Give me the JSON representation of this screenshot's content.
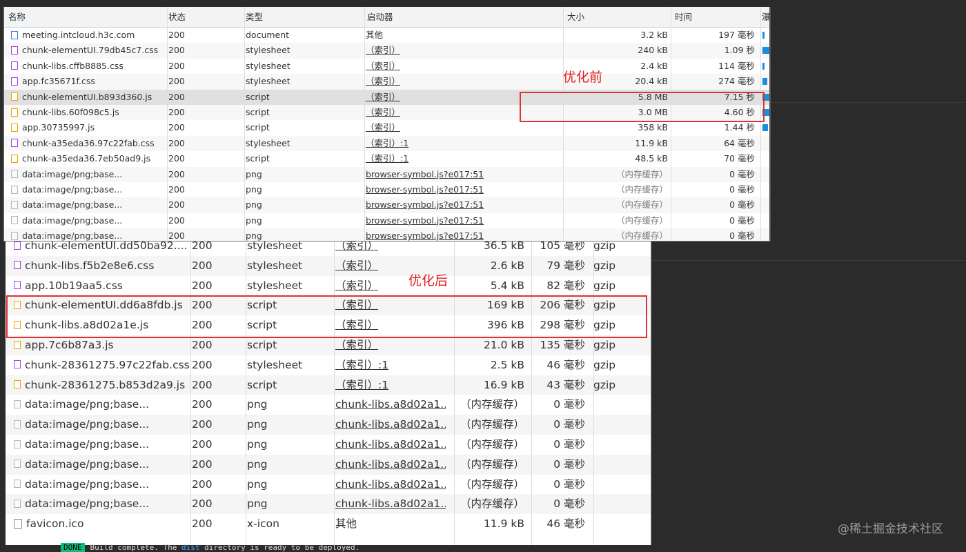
{
  "annotations": {
    "before": "优化前",
    "after": "优化后"
  },
  "before_panel": {
    "headers": {
      "name": "名称",
      "status": "状态",
      "type": "类型",
      "initiator": "启动器",
      "size": "大小",
      "time": "时间",
      "waterfall": "瀑布"
    },
    "rows": [
      {
        "name": "meeting.intcloud.h3c.com",
        "icon": "doc",
        "status": "200",
        "type": "document",
        "initiator": "其他",
        "size": "3.2 kB",
        "time": "197 毫秒"
      },
      {
        "name": "chunk-elementUI.79db45c7.css",
        "icon": "css",
        "status": "200",
        "type": "stylesheet",
        "initiator": "（索引）",
        "size": "240 kB",
        "time": "1.09 秒"
      },
      {
        "name": "chunk-libs.cffb8885.css",
        "icon": "css",
        "status": "200",
        "type": "stylesheet",
        "initiator": "（索引）",
        "size": "2.4 kB",
        "time": "114 毫秒"
      },
      {
        "name": "app.fc35671f.css",
        "icon": "css",
        "status": "200",
        "type": "stylesheet",
        "initiator": "（索引）",
        "size": "20.4 kB",
        "time": "274 毫秒"
      },
      {
        "name": "chunk-elementUI.b893d360.js",
        "icon": "js",
        "status": "200",
        "type": "script",
        "initiator": "（索引）",
        "size": "5.8 MB",
        "time": "7.15 秒"
      },
      {
        "name": "chunk-libs.60f098c5.js",
        "icon": "js",
        "status": "200",
        "type": "script",
        "initiator": "（索引）",
        "size": "3.0 MB",
        "time": "4.60 秒"
      },
      {
        "name": "app.30735997.js",
        "icon": "js",
        "status": "200",
        "type": "script",
        "initiator": "（索引）",
        "size": "358 kB",
        "time": "1.44 秒"
      },
      {
        "name": "chunk-a35eda36.97c22fab.css",
        "icon": "css",
        "status": "200",
        "type": "stylesheet",
        "initiator": "（索引）:1",
        "size": "11.9 kB",
        "time": "64 毫秒"
      },
      {
        "name": "chunk-a35eda36.7eb50ad9.js",
        "icon": "js",
        "status": "200",
        "type": "script",
        "initiator": "（索引）:1",
        "size": "48.5 kB",
        "time": "70 毫秒"
      },
      {
        "name": "data:image/png;base...",
        "icon": "png",
        "status": "200",
        "type": "png",
        "initiator": "browser-symbol.js?e017:51",
        "size": "（内存缓存）",
        "time": "0 毫秒"
      },
      {
        "name": "data:image/png;base...",
        "icon": "png",
        "status": "200",
        "type": "png",
        "initiator": "browser-symbol.js?e017:51",
        "size": "（内存缓存）",
        "time": "0 毫秒"
      },
      {
        "name": "data:image/png;base...",
        "icon": "png",
        "status": "200",
        "type": "png",
        "initiator": "browser-symbol.js?e017:51",
        "size": "（内存缓存）",
        "time": "0 毫秒"
      },
      {
        "name": "data:image/png;base...",
        "icon": "png",
        "status": "200",
        "type": "png",
        "initiator": "browser-symbol.js?e017:51",
        "size": "（内存缓存）",
        "time": "0 毫秒"
      },
      {
        "name": "data:image/png;base...",
        "icon": "png",
        "status": "200",
        "type": "png",
        "initiator": "browser-symbol.js?e017:51",
        "size": "（内存缓存）",
        "time": "0 毫秒"
      }
    ]
  },
  "after_panel": {
    "rows": [
      {
        "name": "chunk-elementUI.dd50ba92....",
        "icon": "css",
        "status": "200",
        "type": "stylesheet",
        "initiator": "（索引）",
        "size": "36.5 kB",
        "time": "105 毫秒",
        "protocol": "gzip"
      },
      {
        "name": "chunk-libs.f5b2e8e6.css",
        "icon": "css",
        "status": "200",
        "type": "stylesheet",
        "initiator": "（索引）",
        "size": "2.6 kB",
        "time": "79 毫秒",
        "protocol": "gzip"
      },
      {
        "name": "app.10b19aa5.css",
        "icon": "css",
        "status": "200",
        "type": "stylesheet",
        "initiator": "（索引）",
        "size": "5.4 kB",
        "time": "82 毫秒",
        "protocol": "gzip"
      },
      {
        "name": "chunk-elementUI.dd6a8fdb.js",
        "icon": "js",
        "status": "200",
        "type": "script",
        "initiator": "（索引）",
        "size": "169 kB",
        "time": "206 毫秒",
        "protocol": "gzip"
      },
      {
        "name": "chunk-libs.a8d02a1e.js",
        "icon": "js",
        "status": "200",
        "type": "script",
        "initiator": "（索引）",
        "size": "396 kB",
        "time": "298 毫秒",
        "protocol": "gzip"
      },
      {
        "name": "app.7c6b87a3.js",
        "icon": "js",
        "status": "200",
        "type": "script",
        "initiator": "（索引）",
        "size": "21.0 kB",
        "time": "135 毫秒",
        "protocol": "gzip"
      },
      {
        "name": "chunk-28361275.97c22fab.css",
        "icon": "css",
        "status": "200",
        "type": "stylesheet",
        "initiator": "（索引）:1",
        "size": "2.5 kB",
        "time": "46 毫秒",
        "protocol": "gzip"
      },
      {
        "name": "chunk-28361275.b853d2a9.js",
        "icon": "js",
        "status": "200",
        "type": "script",
        "initiator": "（索引）:1",
        "size": "16.9 kB",
        "time": "43 毫秒",
        "protocol": "gzip"
      },
      {
        "name": "data:image/png;base...",
        "icon": "png",
        "status": "200",
        "type": "png",
        "initiator": "chunk-libs.a8d02a1...",
        "size": "（内存缓存）",
        "time": "0 毫秒",
        "protocol": ""
      },
      {
        "name": "data:image/png;base...",
        "icon": "png",
        "status": "200",
        "type": "png",
        "initiator": "chunk-libs.a8d02a1...",
        "size": "（内存缓存）",
        "time": "0 毫秒",
        "protocol": ""
      },
      {
        "name": "data:image/png;base...",
        "icon": "png",
        "status": "200",
        "type": "png",
        "initiator": "chunk-libs.a8d02a1...",
        "size": "（内存缓存）",
        "time": "0 毫秒",
        "protocol": ""
      },
      {
        "name": "data:image/png;base...",
        "icon": "png",
        "status": "200",
        "type": "png",
        "initiator": "chunk-libs.a8d02a1...",
        "size": "（内存缓存）",
        "time": "0 毫秒",
        "protocol": ""
      },
      {
        "name": "data:image/png;base...",
        "icon": "png",
        "status": "200",
        "type": "png",
        "initiator": "chunk-libs.a8d02a1...",
        "size": "（内存缓存）",
        "time": "0 毫秒",
        "protocol": ""
      },
      {
        "name": "data:image/png;base...",
        "icon": "png",
        "status": "200",
        "type": "png",
        "initiator": "chunk-libs.a8d02a1...",
        "size": "（内存缓存）",
        "time": "0 毫秒",
        "protocol": ""
      },
      {
        "name": "favicon.ico",
        "icon": "ico",
        "status": "200",
        "type": "x-icon",
        "initiator": "其他",
        "size": "11.9 kB",
        "time": "46 毫秒",
        "protocol": ""
      }
    ]
  },
  "terminal": {
    "badge": "DONE",
    "text_before": "Build complete. The",
    "highlight": "dist",
    "text_after": "directory is ready to be deployed."
  },
  "watermark": "@稀土掘金技术社区",
  "colors": {
    "highlight_box": "#e03030",
    "annotation": "#e41d1d",
    "waterfall": "#1a8fdc"
  }
}
